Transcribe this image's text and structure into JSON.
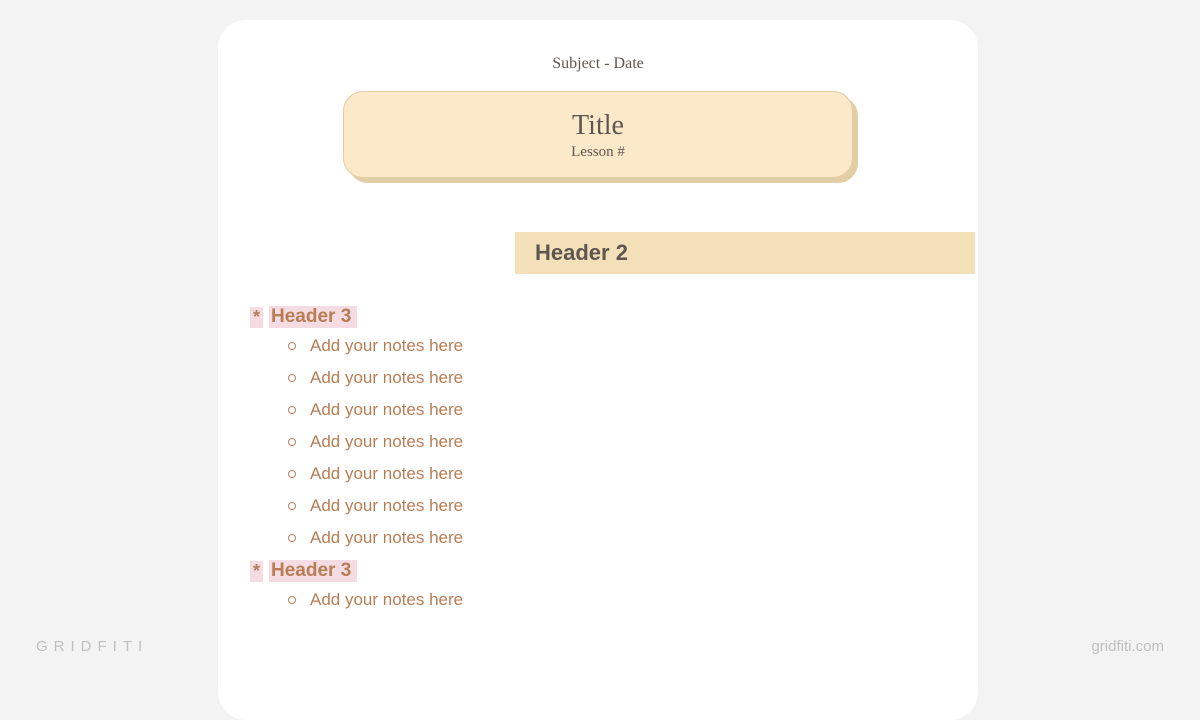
{
  "header": {
    "subject_date": "Subject - Date"
  },
  "titlebox": {
    "title": "Title",
    "subtitle": "Lesson #"
  },
  "header2": "Header 2",
  "sections": [
    {
      "asterisk": "*",
      "header3": "Header 3",
      "notes": [
        "Add your notes here",
        "Add your notes here",
        "Add your notes here",
        "Add your notes here",
        "Add your notes here",
        "Add your notes here",
        "Add your notes here"
      ]
    },
    {
      "asterisk": "*",
      "header3": "Header 3",
      "notes": [
        "Add your notes here"
      ]
    }
  ],
  "watermark": {
    "left": "GRIDFITI",
    "right": "gridfiti.com"
  }
}
